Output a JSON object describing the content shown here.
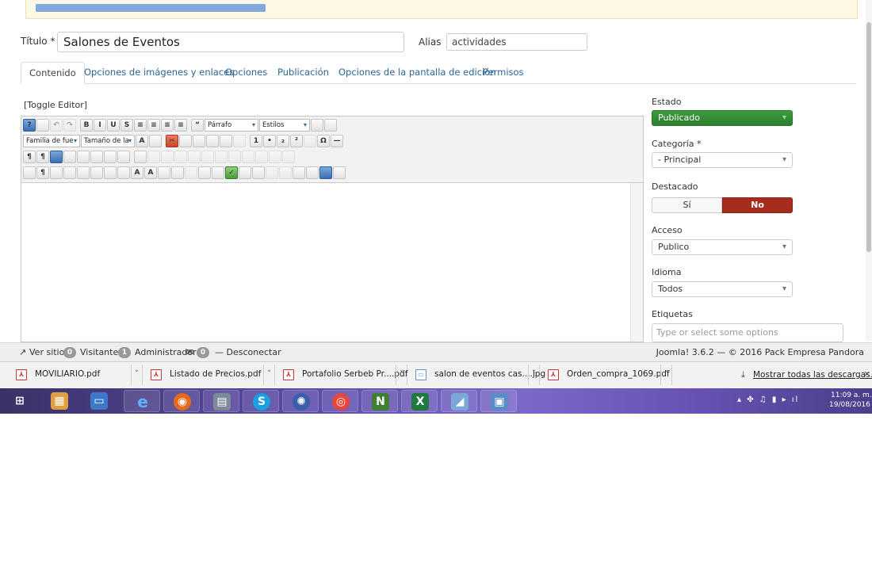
{
  "form": {
    "title_label": "Título *",
    "title_value": "Salones de Eventos",
    "alias_label": "Alias",
    "alias_value": "actividades"
  },
  "tabs": [
    {
      "label": "Contenido",
      "active": true
    },
    {
      "label": "Opciones de imágenes y enlaces"
    },
    {
      "label": "Opciones"
    },
    {
      "label": "Publicación"
    },
    {
      "label": "Opciones de la pantalla de edición"
    },
    {
      "label": "Permisos"
    }
  ],
  "editor": {
    "toggle_label": "[Toggle Editor]",
    "format_select": "Párrafo",
    "styles_select": "Estilos",
    "font_family_select": "Familia de fue",
    "font_size_select": "Tamaño de la"
  },
  "sidebar": {
    "estado_label": "Estado",
    "estado_value": "Publicado",
    "categoria_label": "Categoría *",
    "categoria_value": "- Principal",
    "destacado_label": "Destacado",
    "destacado_yes": "Sí",
    "destacado_no": "No",
    "acceso_label": "Acceso",
    "acceso_value": "Publico",
    "idioma_label": "Idioma",
    "idioma_value": "Todos",
    "etiquetas_label": "Etiquetas",
    "etiquetas_placeholder": "Type or select some options"
  },
  "statusbar": {
    "view_site": "Ver sitio",
    "visitors_count": "0",
    "visitors_label": "Visitantes",
    "admin_count": "1",
    "admin_label": "Administrador",
    "messages_count": "0",
    "logout": "Desconectar",
    "version": "Joomla! 3.6.2 — © 2016 Pack Empresa Pandora"
  },
  "downloads": {
    "items": [
      {
        "name": "MOVILIARIO.pdf",
        "icon": "pdf-icon"
      },
      {
        "name": "Listado de Precios.pdf",
        "icon": "pdf-icon"
      },
      {
        "name": "Portafolio Serbeb Pr....pdf",
        "icon": "pdf-icon"
      },
      {
        "name": "salon de eventos cas....jpg",
        "icon": "image-icon"
      },
      {
        "name": "Orden_compra_1069.pdf",
        "icon": "pdf-icon"
      }
    ],
    "show_all": "Mostrar todas las descargas..."
  },
  "taskbar": {
    "time": "11:09 a. m.",
    "date": "19/08/2016"
  },
  "colors": {
    "published": "#2d8a2d",
    "featured_no": "#a62c1e",
    "link": "#2a6496"
  }
}
